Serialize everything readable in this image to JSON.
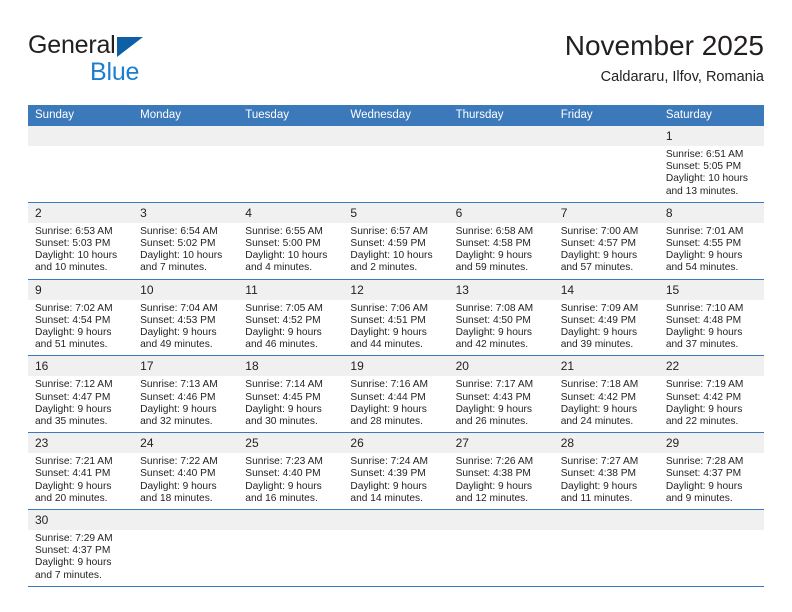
{
  "brand": {
    "name_dark": "General",
    "name_blue": "Blue",
    "triangle_color": "#0f5fa6",
    "blue_color": "#1b7fd1"
  },
  "header": {
    "title": "November 2025",
    "location": "Caldararu, Ilfov, Romania"
  },
  "theme": {
    "header_blue": "#3b79ba",
    "daynum_band": "#f0f0f0",
    "text": "#231f20"
  },
  "weekdays": [
    "Sunday",
    "Monday",
    "Tuesday",
    "Wednesday",
    "Thursday",
    "Friday",
    "Saturday"
  ],
  "labels": {
    "sunrise_prefix": "Sunrise:",
    "sunset_prefix": "Sunset:",
    "daylight_prefix": "Daylight:"
  },
  "weeks": [
    [
      {
        "day": "",
        "blank": true
      },
      {
        "day": "",
        "blank": true
      },
      {
        "day": "",
        "blank": true
      },
      {
        "day": "",
        "blank": true
      },
      {
        "day": "",
        "blank": true
      },
      {
        "day": "",
        "blank": true
      },
      {
        "day": "1",
        "sunrise": "Sunrise: 6:51 AM",
        "sunset": "Sunset: 5:05 PM",
        "daylight": "Daylight: 10 hours and 13 minutes."
      }
    ],
    [
      {
        "day": "2",
        "sunrise": "Sunrise: 6:53 AM",
        "sunset": "Sunset: 5:03 PM",
        "daylight": "Daylight: 10 hours and 10 minutes."
      },
      {
        "day": "3",
        "sunrise": "Sunrise: 6:54 AM",
        "sunset": "Sunset: 5:02 PM",
        "daylight": "Daylight: 10 hours and 7 minutes."
      },
      {
        "day": "4",
        "sunrise": "Sunrise: 6:55 AM",
        "sunset": "Sunset: 5:00 PM",
        "daylight": "Daylight: 10 hours and 4 minutes."
      },
      {
        "day": "5",
        "sunrise": "Sunrise: 6:57 AM",
        "sunset": "Sunset: 4:59 PM",
        "daylight": "Daylight: 10 hours and 2 minutes."
      },
      {
        "day": "6",
        "sunrise": "Sunrise: 6:58 AM",
        "sunset": "Sunset: 4:58 PM",
        "daylight": "Daylight: 9 hours and 59 minutes."
      },
      {
        "day": "7",
        "sunrise": "Sunrise: 7:00 AM",
        "sunset": "Sunset: 4:57 PM",
        "daylight": "Daylight: 9 hours and 57 minutes."
      },
      {
        "day": "8",
        "sunrise": "Sunrise: 7:01 AM",
        "sunset": "Sunset: 4:55 PM",
        "daylight": "Daylight: 9 hours and 54 minutes."
      }
    ],
    [
      {
        "day": "9",
        "sunrise": "Sunrise: 7:02 AM",
        "sunset": "Sunset: 4:54 PM",
        "daylight": "Daylight: 9 hours and 51 minutes."
      },
      {
        "day": "10",
        "sunrise": "Sunrise: 7:04 AM",
        "sunset": "Sunset: 4:53 PM",
        "daylight": "Daylight: 9 hours and 49 minutes."
      },
      {
        "day": "11",
        "sunrise": "Sunrise: 7:05 AM",
        "sunset": "Sunset: 4:52 PM",
        "daylight": "Daylight: 9 hours and 46 minutes."
      },
      {
        "day": "12",
        "sunrise": "Sunrise: 7:06 AM",
        "sunset": "Sunset: 4:51 PM",
        "daylight": "Daylight: 9 hours and 44 minutes."
      },
      {
        "day": "13",
        "sunrise": "Sunrise: 7:08 AM",
        "sunset": "Sunset: 4:50 PM",
        "daylight": "Daylight: 9 hours and 42 minutes."
      },
      {
        "day": "14",
        "sunrise": "Sunrise: 7:09 AM",
        "sunset": "Sunset: 4:49 PM",
        "daylight": "Daylight: 9 hours and 39 minutes."
      },
      {
        "day": "15",
        "sunrise": "Sunrise: 7:10 AM",
        "sunset": "Sunset: 4:48 PM",
        "daylight": "Daylight: 9 hours and 37 minutes."
      }
    ],
    [
      {
        "day": "16",
        "sunrise": "Sunrise: 7:12 AM",
        "sunset": "Sunset: 4:47 PM",
        "daylight": "Daylight: 9 hours and 35 minutes."
      },
      {
        "day": "17",
        "sunrise": "Sunrise: 7:13 AM",
        "sunset": "Sunset: 4:46 PM",
        "daylight": "Daylight: 9 hours and 32 minutes."
      },
      {
        "day": "18",
        "sunrise": "Sunrise: 7:14 AM",
        "sunset": "Sunset: 4:45 PM",
        "daylight": "Daylight: 9 hours and 30 minutes."
      },
      {
        "day": "19",
        "sunrise": "Sunrise: 7:16 AM",
        "sunset": "Sunset: 4:44 PM",
        "daylight": "Daylight: 9 hours and 28 minutes."
      },
      {
        "day": "20",
        "sunrise": "Sunrise: 7:17 AM",
        "sunset": "Sunset: 4:43 PM",
        "daylight": "Daylight: 9 hours and 26 minutes."
      },
      {
        "day": "21",
        "sunrise": "Sunrise: 7:18 AM",
        "sunset": "Sunset: 4:42 PM",
        "daylight": "Daylight: 9 hours and 24 minutes."
      },
      {
        "day": "22",
        "sunrise": "Sunrise: 7:19 AM",
        "sunset": "Sunset: 4:42 PM",
        "daylight": "Daylight: 9 hours and 22 minutes."
      }
    ],
    [
      {
        "day": "23",
        "sunrise": "Sunrise: 7:21 AM",
        "sunset": "Sunset: 4:41 PM",
        "daylight": "Daylight: 9 hours and 20 minutes."
      },
      {
        "day": "24",
        "sunrise": "Sunrise: 7:22 AM",
        "sunset": "Sunset: 4:40 PM",
        "daylight": "Daylight: 9 hours and 18 minutes."
      },
      {
        "day": "25",
        "sunrise": "Sunrise: 7:23 AM",
        "sunset": "Sunset: 4:40 PM",
        "daylight": "Daylight: 9 hours and 16 minutes."
      },
      {
        "day": "26",
        "sunrise": "Sunrise: 7:24 AM",
        "sunset": "Sunset: 4:39 PM",
        "daylight": "Daylight: 9 hours and 14 minutes."
      },
      {
        "day": "27",
        "sunrise": "Sunrise: 7:26 AM",
        "sunset": "Sunset: 4:38 PM",
        "daylight": "Daylight: 9 hours and 12 minutes."
      },
      {
        "day": "28",
        "sunrise": "Sunrise: 7:27 AM",
        "sunset": "Sunset: 4:38 PM",
        "daylight": "Daylight: 9 hours and 11 minutes."
      },
      {
        "day": "29",
        "sunrise": "Sunrise: 7:28 AM",
        "sunset": "Sunset: 4:37 PM",
        "daylight": "Daylight: 9 hours and 9 minutes."
      }
    ],
    [
      {
        "day": "30",
        "sunrise": "Sunrise: 7:29 AM",
        "sunset": "Sunset: 4:37 PM",
        "daylight": "Daylight: 9 hours and 7 minutes."
      },
      {
        "day": "",
        "blank": true
      },
      {
        "day": "",
        "blank": true
      },
      {
        "day": "",
        "blank": true
      },
      {
        "day": "",
        "blank": true
      },
      {
        "day": "",
        "blank": true
      },
      {
        "day": "",
        "blank": true
      }
    ]
  ]
}
